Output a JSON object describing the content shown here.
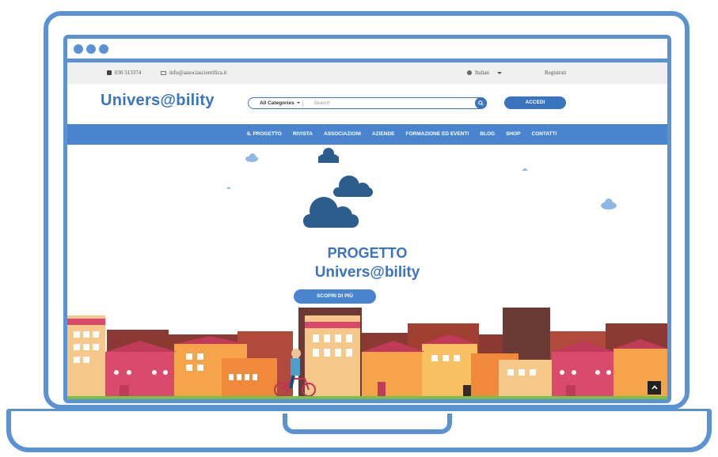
{
  "topbar": {
    "phone": "030 313374",
    "email": "info@associascientifica.it",
    "language": "Italian",
    "register": "Registrati"
  },
  "header": {
    "logo_text_1": "Univers",
    "logo_at": "@",
    "logo_text_2": "bility",
    "search_category": "All Categories",
    "search_placeholder": "Search",
    "login_button": "ACCEDI"
  },
  "nav": {
    "items": [
      "IL PROGETTO",
      "RIVISTA",
      "ASSOCIAZIONI",
      "AZIENDE",
      "FORMAZIONE ED EVENTI",
      "BLOG",
      "SHOP",
      "CONTATTI"
    ]
  },
  "hero": {
    "title": "PROGETTO",
    "logo_text_1": "Univers",
    "logo_at": "@",
    "logo_text_2": "bility",
    "cta": "SCOPRI DI PIÙ"
  },
  "colors": {
    "frame": "#5b92d3",
    "brand": "#3a73be",
    "nav": "#4a84cf",
    "cloud_dark": "#2c5d8c",
    "cloud_light": "#8fb8e3"
  }
}
